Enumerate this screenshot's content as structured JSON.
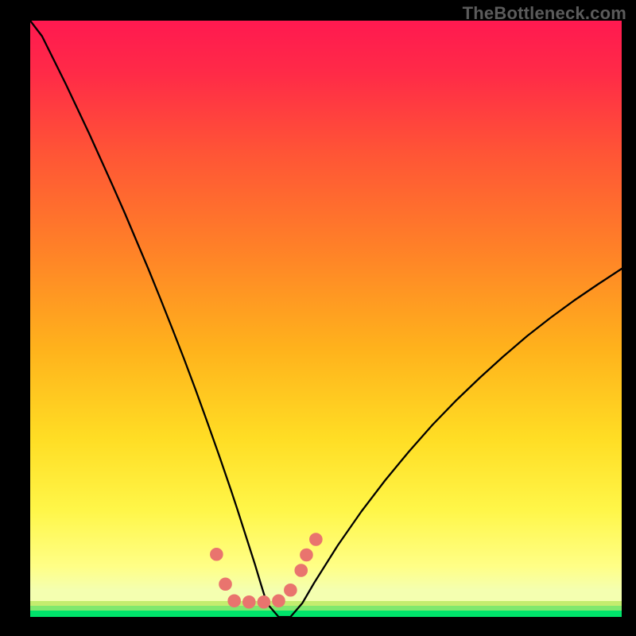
{
  "watermark": "TheBottleneck.com",
  "colors": {
    "bg": "#000000",
    "curve": "#000000",
    "marker_fill": "#e9746e",
    "marker_stroke": "#e9746e",
    "green": "#00e36b",
    "green_strip_top": "#7fe86e",
    "green_strip_mid": "#c4ec6e"
  },
  "chart_data": {
    "type": "line",
    "title": "",
    "xlabel": "",
    "ylabel": "",
    "xlim": [
      0,
      100
    ],
    "ylim": [
      0,
      100
    ],
    "x": [
      0,
      2,
      4,
      6,
      8,
      10,
      12,
      14,
      16,
      18,
      20,
      22,
      24,
      26,
      28,
      30,
      32,
      33,
      34,
      35,
      36,
      37,
      38,
      39,
      40,
      42,
      44,
      46,
      48,
      52,
      56,
      60,
      64,
      68,
      72,
      76,
      80,
      84,
      88,
      92,
      96,
      100
    ],
    "series": [
      {
        "name": "curve",
        "values": [
          100,
          97.4,
          93.4,
          89.4,
          85.2,
          81.0,
          76.6,
          72.2,
          67.7,
          63.0,
          58.3,
          53.4,
          48.4,
          43.3,
          38.0,
          32.5,
          26.9,
          24.0,
          21.1,
          18.1,
          15.0,
          11.9,
          8.8,
          5.5,
          2.3,
          0.0,
          0.0,
          2.3,
          5.7,
          12.0,
          17.7,
          22.9,
          27.7,
          32.2,
          36.3,
          40.1,
          43.7,
          47.1,
          50.2,
          53.1,
          55.8,
          58.4
        ]
      }
    ],
    "markers": [
      {
        "x": 31.5,
        "y": 10.5
      },
      {
        "x": 33.0,
        "y": 5.5
      },
      {
        "x": 34.5,
        "y": 2.7
      },
      {
        "x": 37.0,
        "y": 2.5
      },
      {
        "x": 39.5,
        "y": 2.5
      },
      {
        "x": 42.0,
        "y": 2.7
      },
      {
        "x": 44.0,
        "y": 4.5
      },
      {
        "x": 45.8,
        "y": 7.8
      },
      {
        "x": 46.7,
        "y": 10.4
      },
      {
        "x": 48.3,
        "y": 13.0
      }
    ],
    "marker_r": 1.05
  }
}
